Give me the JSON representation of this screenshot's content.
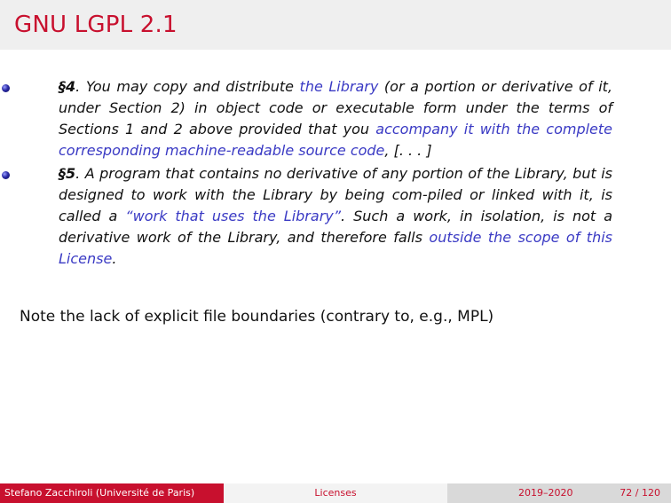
{
  "header": {
    "title": "GNU LGPL 2.1"
  },
  "items": [
    {
      "section": "§4",
      "s1": ". You may copy and distribute ",
      "h1": "the Library",
      "s2": " (or a portion or derivative of it, under Section 2) in object code or executable form under the terms of Sections 1 and 2 above provided that you ",
      "h2": "accompany it with the complete corresponding machine-readable source code",
      "s3": ", [. . . ]"
    },
    {
      "section": "§5",
      "s1": ". A program that contains no derivative of any portion of the Library, but is designed to work with the Library by being com-piled or linked with it, is called a ",
      "h1": "“work that uses the Library”",
      "s2": ". Such a work, in isolation, is not a derivative work of the Library, and therefore falls ",
      "h2": "outside the scope of this License",
      "s3": "."
    }
  ],
  "note": "Note the lack of explicit file boundaries (contrary to, e.g., MPL)",
  "footer": {
    "author": "Stefano Zacchiroli (Université de Paris)",
    "topic": "Licenses",
    "date": "2019–2020",
    "page": "72 / 120"
  }
}
